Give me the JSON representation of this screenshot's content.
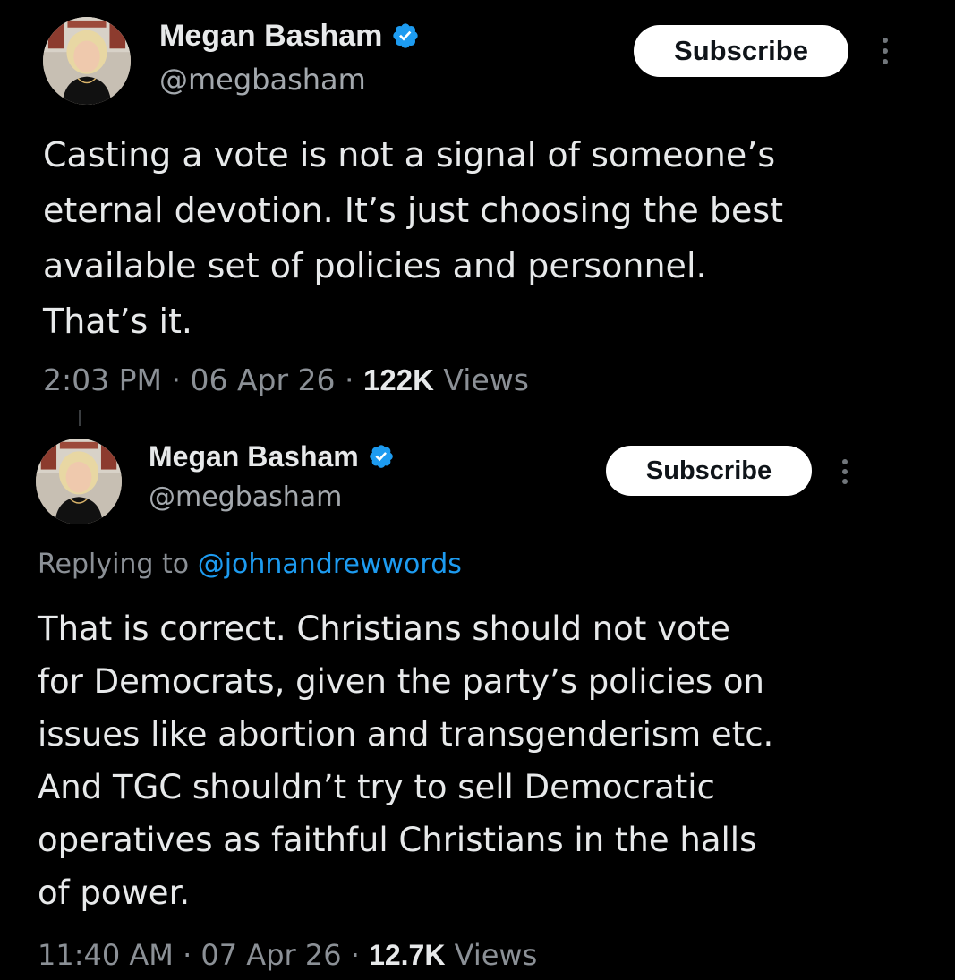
{
  "colors": {
    "background": "#000000",
    "text_primary": "#e7e9ea",
    "text_secondary": "#8b9096",
    "link": "#1d9bf0",
    "verified_badge": "#1d9bf0",
    "subscribe_bg": "#ffffff",
    "subscribe_text": "#0f1419"
  },
  "tweets": [
    {
      "author": {
        "display_name": "Megan Basham",
        "handle": "@megbasham",
        "verified": true,
        "avatar_icon": "profile-photo"
      },
      "subscribe_label": "Subscribe",
      "more_icon": "more-vertical-icon",
      "text_lines": [
        "Casting a vote is not a signal of someone’s",
        "eternal devotion. It’s just choosing the best",
        "available set of policies and personnel.",
        "That’s it."
      ],
      "time": "2:03 PM",
      "date": "06 Apr 26",
      "separator": "·",
      "views_count": "122K",
      "views_label": "Views"
    },
    {
      "author": {
        "display_name": "Megan Basham",
        "handle": "@megbasham",
        "verified": true,
        "avatar_icon": "profile-photo"
      },
      "subscribe_label": "Subscribe",
      "more_icon": "more-vertical-icon",
      "replying_to_label": "Replying to",
      "replying_to_handle": "@johnandrewwords",
      "text_lines": [
        "That is correct. Christians should not vote",
        "for Democrats, given the party’s policies on",
        "issues like abortion and transgenderism etc.",
        "And TGC shouldn’t try to sell Democratic",
        "operatives as faithful Christians in the halls",
        "of power."
      ],
      "time": "11:40 AM",
      "date": "07 Apr 26",
      "separator": "·",
      "views_count": "12.7K",
      "views_label": "Views"
    }
  ]
}
